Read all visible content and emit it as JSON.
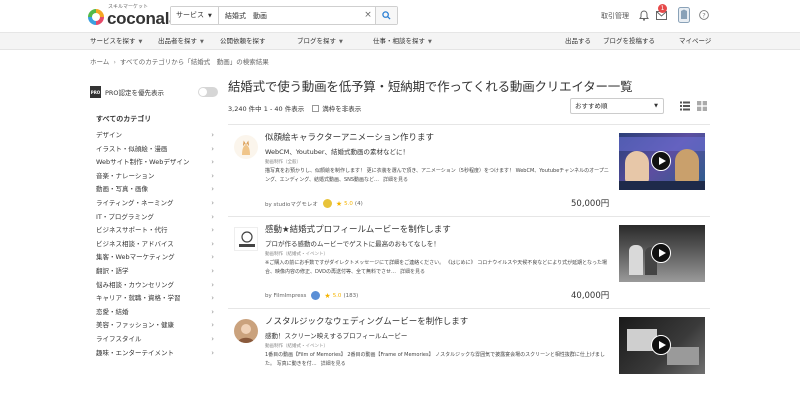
{
  "header": {
    "logo_text": "coconala",
    "logo_sub": "スキルマーケット",
    "search_category": "サービス",
    "search_value": "結婚式　動画",
    "clear_glyph": "×",
    "purchase_mgmt": "取引管理",
    "notification_count": "1"
  },
  "nav": {
    "left": [
      "サービスを探す",
      "出品者を探す",
      "公開依頼を探す",
      "ブログを探す",
      "仕事・相談を探す"
    ],
    "right": [
      "出品する",
      "ブログを投稿する",
      "マイページ"
    ]
  },
  "breadcrumb": {
    "home": "ホーム",
    "path": "すべてのカテゴリから「結婚式　動画」の検索結果"
  },
  "sidebar": {
    "pro_logo": "PRO",
    "pro_label": "PRO認定を優先表示",
    "category_heading": "すべてのカテゴリ",
    "categories": [
      "デザイン",
      "イラスト・似顔絵・漫画",
      "Webサイト制作・Webデザイン",
      "音楽・ナレーション",
      "動画・写真・画像",
      "ライティング・ネーミング",
      "IT・プログラミング",
      "ビジネスサポート・代行",
      "ビジネス相談・アドバイス",
      "集客・Webマーケティング",
      "翻訳・語学",
      "悩み相談・カウンセリング",
      "キャリア・就職・資格・学習",
      "恋愛・結婚",
      "美容・ファッション・健康",
      "ライフスタイル",
      "趣味・エンターテイメント"
    ]
  },
  "main": {
    "title": "結婚式で使う動画を低予算・短納期で作ってくれる動画クリエイター一覧",
    "count_text": "3,240 件中 1 - 40 件表示",
    "checkbox_label": "満枠を非表示",
    "sort_value": "おすすめ順",
    "listings": [
      {
        "title": "似顔絵キャラクターアニメーション作ります",
        "desc": "WebCM、Youtuber、結婚式動画の素材などに！",
        "category": "動画制作（全般）",
        "body": "描写真をお預かりし、似顔絵を制作します！ 更に衣装を選んで頂き、アニメーション（5秒程度）をつけます！ WebCM、Youtubeチャンネルのオープニング、エンディング、結婚式動画、SNS動画など…",
        "more": "詳細を見る",
        "seller": "by studioマグモレオ",
        "rating": "5.0",
        "reviews": "(4)",
        "price": "50,000円",
        "medal_color": "#e8c33a"
      },
      {
        "title": "感動★結婚式プロフィールムービーを制作します",
        "desc": "プロが作る感動のムービーでゲストに最高のおもてなしを！",
        "category": "動画制作（結婚式・イベント）",
        "body": "※ご購入の前にお手数ですがダイレクトメッセージにて詳細をご連絡ください。 《はじめに》 コロナウイルスや天候不良などにより式が延期となった場合、映像内容の修正、DVDの再送付等、全て無料でさせ…",
        "more": "詳細を見る",
        "seller": "by FilmImpress",
        "rating": "5.0",
        "reviews": "(183)",
        "price": "40,000円",
        "medal_color": "#5b8fd6"
      },
      {
        "title": "ノスタルジックなウェディングムービーを制作します",
        "desc": "感動！スクリーン映えするプロフィールムービー",
        "category": "動画制作（結婚式・イベント）",
        "body": "1番目の動画【Film of Memories】 2番目の動画【Frame of Memories】 ノスタルジックな雰囲気で披露宴会場のスクリーンと相性抜群に仕上げました。 写真に動きを付…",
        "more": "詳細を見る"
      }
    ]
  }
}
